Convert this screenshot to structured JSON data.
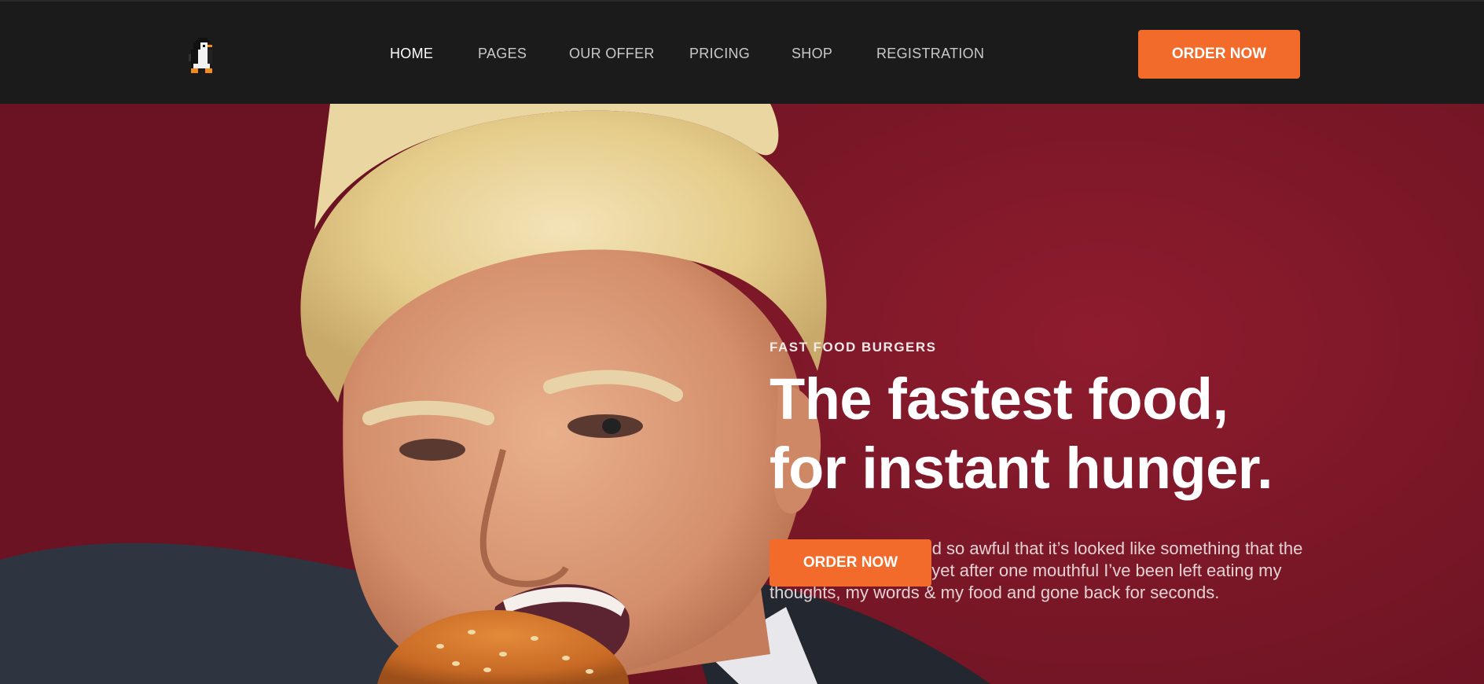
{
  "header": {
    "logo_icon": "penguin-logo-icon",
    "nav": [
      {
        "label": "HOME",
        "active": true
      },
      {
        "label": "PAGES",
        "active": false
      },
      {
        "label": "OUR OFFER",
        "active": false
      },
      {
        "label": "PRICING",
        "active": false
      },
      {
        "label": "SHOP",
        "active": false
      },
      {
        "label": "REGISTRATION",
        "active": false
      }
    ],
    "cta_label": "ORDER NOW"
  },
  "hero": {
    "eyebrow": "FAST FOOD BURGERS",
    "headline": "The fastest food, for instant hunger.",
    "lede": "Some food has looked so awful that it’s looked like something that the dog’s brought home, yet after one mouthful I’ve been left eating my thoughts, my words & my food and gone back for seconds.",
    "cta_label": "ORDER NOW"
  },
  "colors": {
    "header_bg": "#1b1b1b",
    "accent": "#f26b2a",
    "hero_bg": "#7a1727"
  }
}
